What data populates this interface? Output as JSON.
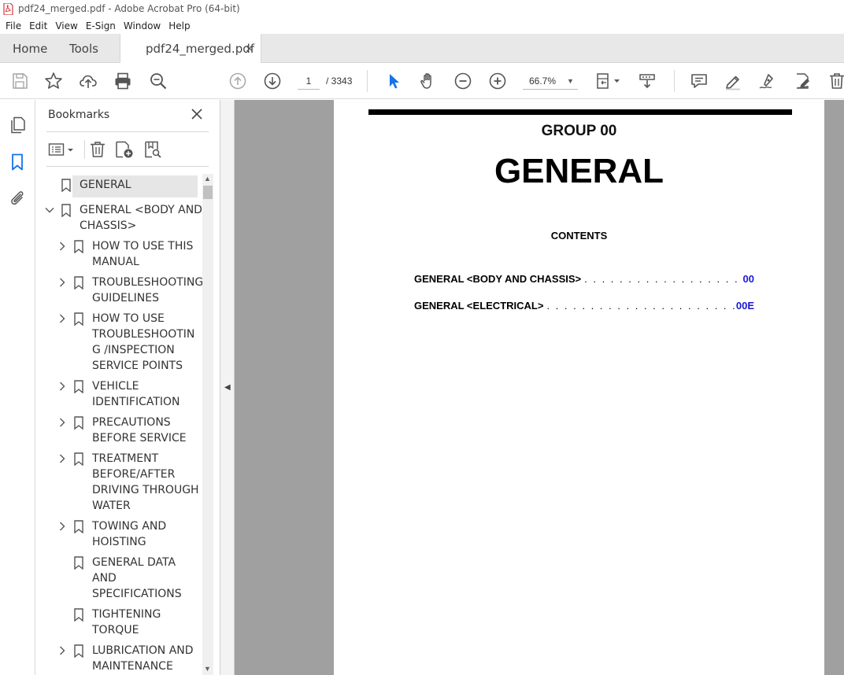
{
  "window": {
    "title": "pdf24_merged.pdf - Adobe Acrobat Pro (64-bit)"
  },
  "menubar": {
    "items": [
      "File",
      "Edit",
      "View",
      "E-Sign",
      "Window",
      "Help"
    ]
  },
  "tabs": {
    "home": "Home",
    "tools": "Tools",
    "document": "pdf24_merged.pdf",
    "close": "×"
  },
  "toolbar": {
    "page_current": "1",
    "page_total": "/ 3343",
    "zoom": "66.7%"
  },
  "bookmarks": {
    "header": "Bookmarks",
    "items": [
      {
        "label": "GENERAL",
        "level": 0,
        "expander": "none"
      },
      {
        "label": "GENERAL <BODY AND CHASSIS>",
        "level": 0,
        "expander": "expanded"
      },
      {
        "label": "HOW TO USE THIS MANUAL",
        "level": 1,
        "expander": "collapsed"
      },
      {
        "label": "TROUBLESHOOTING GUIDELINES",
        "level": 1,
        "expander": "collapsed"
      },
      {
        "label": "HOW TO USE TROUBLESHOOTING /INSPECTION SERVICE POINTS",
        "level": 1,
        "expander": "collapsed"
      },
      {
        "label": "VEHICLE IDENTIFICATION",
        "level": 1,
        "expander": "collapsed"
      },
      {
        "label": "PRECAUTIONS BEFORE SERVICE",
        "level": 1,
        "expander": "collapsed"
      },
      {
        "label": "TREATMENT BEFORE/AFTER DRIVING THROUGH WATER",
        "level": 1,
        "expander": "collapsed"
      },
      {
        "label": "TOWING AND HOISTING",
        "level": 1,
        "expander": "collapsed"
      },
      {
        "label": "GENERAL DATA AND SPECIFICATIONS",
        "level": 1,
        "expander": "none"
      },
      {
        "label": "TIGHTENING TORQUE",
        "level": 1,
        "expander": "none"
      },
      {
        "label": "LUBRICATION AND MAINTENANCE",
        "level": 1,
        "expander": "collapsed"
      }
    ]
  },
  "document": {
    "group": "GROUP 00",
    "title": "GENERAL",
    "contents_heading": "CONTENTS",
    "toc": [
      {
        "label": "GENERAL <BODY AND CHASSIS>",
        "dots": ". . . . . . . . . . . . . . . . . . . . . . . . . . . . . . . .",
        "page": "00"
      },
      {
        "label": "GENERAL <ELECTRICAL>",
        "dots": ". . . . . . . . . . . . . . . . . . . . . . . . . . . . . . . . . . . . .",
        "page": "00E"
      }
    ]
  },
  "colors": {
    "accent_blue": "#1473e6",
    "toc_link": "#1a1ad4",
    "doc_background": "#a0a0a0"
  }
}
